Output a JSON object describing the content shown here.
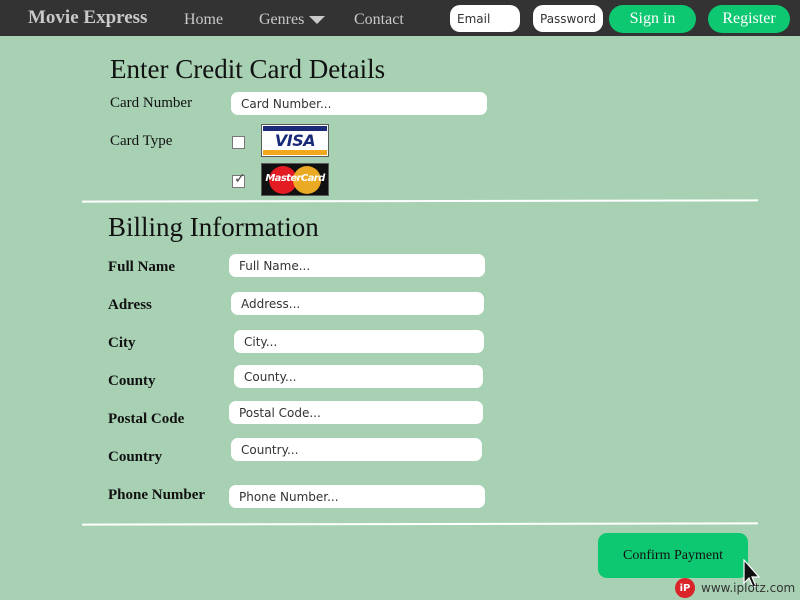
{
  "navbar": {
    "brand": "Movie Express",
    "links": [
      "Home",
      "Genres",
      "Contact"
    ],
    "email_placeholder": "Email",
    "password_placeholder": "Password",
    "signin_label": "Sign in",
    "register_label": "Register"
  },
  "card_section": {
    "title": "Enter Credit Card Details",
    "card_number_label": "Card Number",
    "card_number_placeholder": "Card Number...",
    "card_type_label": "Card Type",
    "options": [
      {
        "name": "VISA",
        "checked": false
      },
      {
        "name": "MasterCard",
        "checked": true
      }
    ]
  },
  "billing_section": {
    "title": "Billing Information",
    "fields": [
      {
        "label": "Full Name",
        "placeholder": "Full Name..."
      },
      {
        "label": "Adress",
        "placeholder": "Address..."
      },
      {
        "label": "City",
        "placeholder": "City..."
      },
      {
        "label": "County",
        "placeholder": "County..."
      },
      {
        "label": "Postal Code",
        "placeholder": "Postal Code..."
      },
      {
        "label": "Country",
        "placeholder": "Country..."
      },
      {
        "label": "Phone Number",
        "placeholder": "Phone Number..."
      }
    ]
  },
  "confirm_label": "Confirm Payment",
  "watermark": {
    "logo": "iP",
    "text": "www.iplotz.com"
  },
  "colors": {
    "accent": "#0ec771",
    "background": "#a8d1b4",
    "navbar": "#333333"
  }
}
